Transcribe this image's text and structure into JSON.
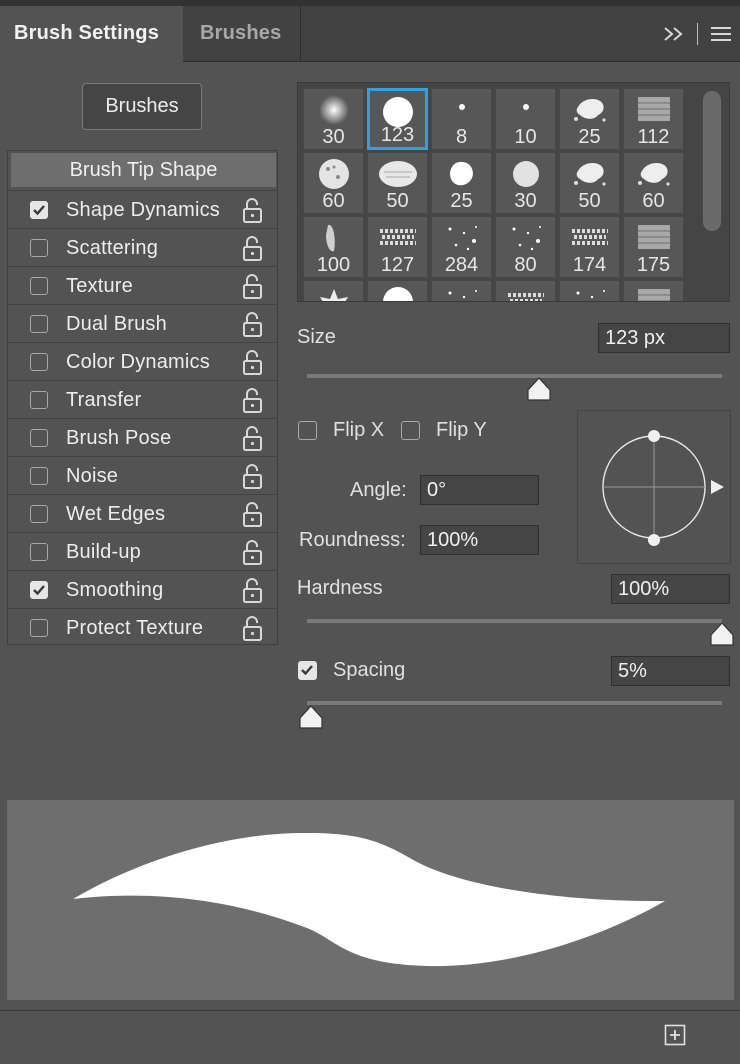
{
  "tabs": {
    "active": "Brush Settings",
    "inactive": "Brushes"
  },
  "brushes_button": "Brushes",
  "options": {
    "header": "Brush Tip Shape",
    "items": [
      {
        "label": "Shape Dynamics",
        "checked": true
      },
      {
        "label": "Scattering",
        "checked": false
      },
      {
        "label": "Texture",
        "checked": false
      },
      {
        "label": "Dual Brush",
        "checked": false
      },
      {
        "label": "Color Dynamics",
        "checked": false
      },
      {
        "label": "Transfer",
        "checked": false
      },
      {
        "label": "Brush Pose",
        "checked": false
      },
      {
        "label": "Noise",
        "checked": false
      },
      {
        "label": "Wet Edges",
        "checked": false
      },
      {
        "label": "Build-up",
        "checked": false
      },
      {
        "label": "Smoothing",
        "checked": true
      },
      {
        "label": "Protect Texture",
        "checked": false
      }
    ]
  },
  "presets": [
    {
      "size": "30",
      "shape": "soft-round"
    },
    {
      "size": "123",
      "shape": "hard-round",
      "selected": true
    },
    {
      "size": "8",
      "shape": "tiny-dot"
    },
    {
      "size": "10",
      "shape": "tiny-dot"
    },
    {
      "size": "25",
      "shape": "splatter"
    },
    {
      "size": "112",
      "shape": "texture"
    },
    {
      "size": "60",
      "shape": "textured-round"
    },
    {
      "size": "50",
      "shape": "textured-oval"
    },
    {
      "size": "25",
      "shape": "blob"
    },
    {
      "size": "30",
      "shape": "soft-blob"
    },
    {
      "size": "50",
      "shape": "splatter"
    },
    {
      "size": "60",
      "shape": "splatter"
    },
    {
      "size": "100",
      "shape": "bristle"
    },
    {
      "size": "127",
      "shape": "chalk"
    },
    {
      "size": "284",
      "shape": "scatter"
    },
    {
      "size": "80",
      "shape": "scatter"
    },
    {
      "size": "174",
      "shape": "chalk"
    },
    {
      "size": "175",
      "shape": "texture"
    },
    {
      "size": "",
      "shape": "leaf"
    },
    {
      "size": "",
      "shape": "hard-round"
    },
    {
      "size": "",
      "shape": "scatter"
    },
    {
      "size": "",
      "shape": "chalk"
    },
    {
      "size": "",
      "shape": "scatter"
    },
    {
      "size": "",
      "shape": "texture"
    }
  ],
  "size": {
    "label": "Size",
    "value": "123 px",
    "fraction": 0.56
  },
  "flip_x": {
    "label": "Flip X",
    "checked": false
  },
  "flip_y": {
    "label": "Flip Y",
    "checked": false
  },
  "angle": {
    "label": "Angle:",
    "value": "0°"
  },
  "roundness": {
    "label": "Roundness:",
    "value": "100%"
  },
  "hardness": {
    "label": "Hardness",
    "value": "100%",
    "fraction": 1.0
  },
  "spacing": {
    "label": "Spacing",
    "value": "5%",
    "checked": true,
    "fraction": 0.01
  },
  "colors": {
    "panel_bg": "#535353",
    "selection": "#2da2e0",
    "preview_bg": "#6e6e6e"
  }
}
